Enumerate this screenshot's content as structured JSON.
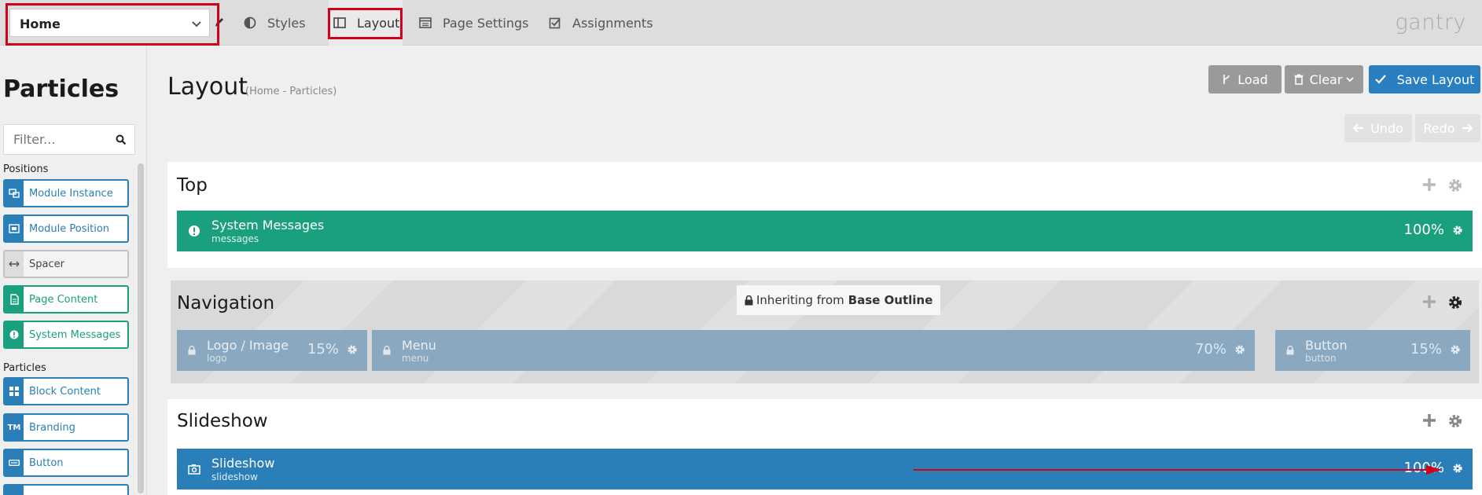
{
  "topbar": {
    "outline_value": "Home",
    "tabs": [
      {
        "label": "Styles",
        "icon": "half-circle-icon"
      },
      {
        "label": "Layout",
        "icon": "columns-icon",
        "active": true
      },
      {
        "label": "Page Settings",
        "icon": "list-window-icon"
      },
      {
        "label": "Assignments",
        "icon": "check-square-icon"
      }
    ],
    "brand": "gantry"
  },
  "sidebar": {
    "title": "Particles",
    "filter_placeholder": "Filter...",
    "positions_label": "Positions",
    "particles_label": "Particles",
    "positions": [
      {
        "label": "Module Instance",
        "style": "blue",
        "icon": "module-instance-icon"
      },
      {
        "label": "Module Position",
        "style": "blue",
        "icon": "module-position-icon"
      },
      {
        "label": "Spacer",
        "style": "gray",
        "icon": "spacer-icon"
      },
      {
        "label": "Page Content",
        "style": "green",
        "icon": "page-content-icon"
      },
      {
        "label": "System Messages",
        "style": "green",
        "icon": "alert-icon"
      }
    ],
    "particles": [
      {
        "label": "Block Content",
        "style": "blue",
        "icon": "grid-icon"
      },
      {
        "label": "Branding",
        "style": "blue",
        "icon": "tm-icon"
      },
      {
        "label": "Button",
        "style": "blue",
        "icon": "button-icon"
      }
    ]
  },
  "main": {
    "title": "Layout",
    "subtitle": "(Home - Particles)",
    "buttons": {
      "load": "Load",
      "clear": "Clear",
      "save": "Save Layout",
      "undo": "Undo",
      "redo": "Redo"
    },
    "sections": {
      "top": {
        "title": "Top",
        "blocks": [
          {
            "name": "System Messages",
            "type": "messages",
            "width": "100%"
          }
        ]
      },
      "navigation": {
        "title": "Navigation",
        "inherit_prefix": "Inheriting from",
        "inherit_source": "Base Outline",
        "blocks": [
          {
            "name": "Logo / Image",
            "type": "logo",
            "width": "15%"
          },
          {
            "name": "Menu",
            "type": "menu",
            "width": "70%"
          },
          {
            "name": "Button",
            "type": "button",
            "width": "15%"
          }
        ]
      },
      "slideshow": {
        "title": "Slideshow",
        "blocks": [
          {
            "name": "Slideshow",
            "type": "slideshow",
            "width": "100%"
          }
        ]
      }
    }
  },
  "colors": {
    "green": "#1aa07f",
    "blue": "#2a7fb8",
    "nav_block": "#8aa9c1",
    "annotation_red": "#d0021b"
  }
}
